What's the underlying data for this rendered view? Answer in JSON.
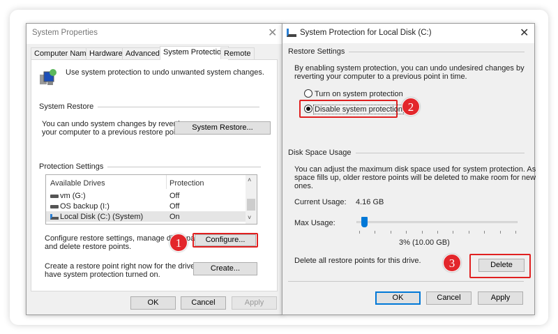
{
  "left_dialog": {
    "title": "System Properties",
    "tabs": [
      "Computer Name",
      "Hardware",
      "Advanced",
      "System Protection",
      "Remote"
    ],
    "active_tab": "System Protection",
    "intro": "Use system protection to undo unwanted system changes.",
    "system_restore": {
      "heading": "System Restore",
      "text1": "You can undo system changes by reverting",
      "text2": "your computer to a previous restore point.",
      "button": "System Restore..."
    },
    "protection": {
      "heading": "Protection Settings",
      "columns": [
        "Available Drives",
        "Protection"
      ],
      "rows": [
        {
          "drive": "vm (G:)",
          "protection": "Off"
        },
        {
          "drive": "OS backup (I:)",
          "protection": "Off"
        },
        {
          "drive": "Local Disk (C:) (System)",
          "protection": "On"
        }
      ],
      "configure_text1": "Configure restore settings, manage disk spa",
      "configure_text2": "and delete restore points.",
      "configure_button": "Configure...",
      "create_text1": "Create a restore point right now for the drives that",
      "create_text2": "have system protection turned on.",
      "create_button": "Create..."
    },
    "buttons": {
      "ok": "OK",
      "cancel": "Cancel",
      "apply": "Apply"
    }
  },
  "right_dialog": {
    "title": "System Protection for Local Disk (C:)",
    "restore": {
      "heading": "Restore Settings",
      "text1": "By enabling system protection, you can undo undesired changes by",
      "text2": "reverting your computer to a previous point in time.",
      "option_on": "Turn on system protection",
      "option_off": "Disable system protection",
      "selected": "Disable system protection"
    },
    "disk": {
      "heading": "Disk Space Usage",
      "text1": "You can adjust the maximum disk space used for system protection. As",
      "text2": "space fills up, older restore points will be deleted to make room for new",
      "text3": "ones.",
      "current_label": "Current Usage:",
      "current_value": "4.16 GB",
      "max_label": "Max Usage:",
      "max_percent": 3,
      "max_value": "3% (10.00 GB)",
      "delete_text": "Delete all restore points for this drive.",
      "delete_button": "Delete"
    },
    "buttons": {
      "ok": "OK",
      "cancel": "Cancel",
      "apply": "Apply"
    }
  },
  "annotations": [
    "1",
    "2",
    "3"
  ],
  "colors": {
    "accent": "#0078d7",
    "highlight": "#e02020"
  }
}
